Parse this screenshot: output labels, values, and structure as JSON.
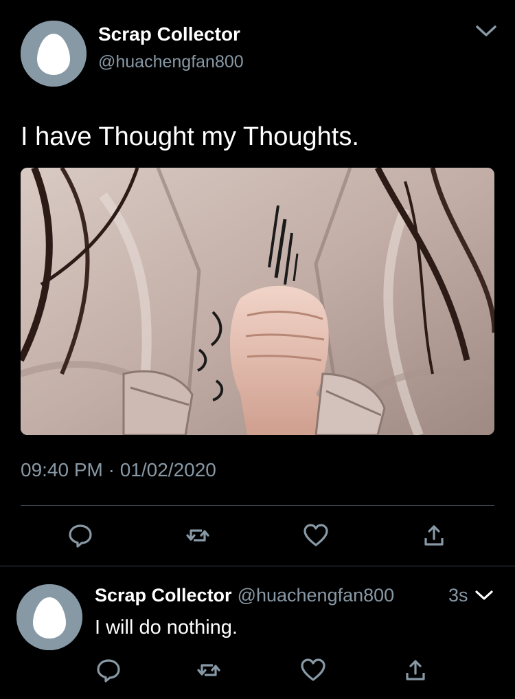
{
  "tweet": {
    "author_name": "Scrap Collector",
    "author_handle": "@huachengfan800",
    "text": "I have Thought my Thoughts.",
    "timestamp": "09:40 PM · 01/02/2020",
    "media_icon": "illustration-hands-clasped",
    "actions": [
      "reply-icon",
      "retweet-icon",
      "like-icon",
      "share-icon"
    ]
  },
  "reply": {
    "author_name": "Scrap Collector",
    "author_handle": "@huachengfan800",
    "time": "3s",
    "text": "I will do nothing.",
    "actions": [
      "reply-icon",
      "retweet-icon",
      "like-icon",
      "share-icon"
    ]
  },
  "colors": {
    "background": "#000000",
    "text": "#ffffff",
    "secondary_text": "#8899a6",
    "divider": "#38444d",
    "avatar_bg": "#8899a6"
  }
}
